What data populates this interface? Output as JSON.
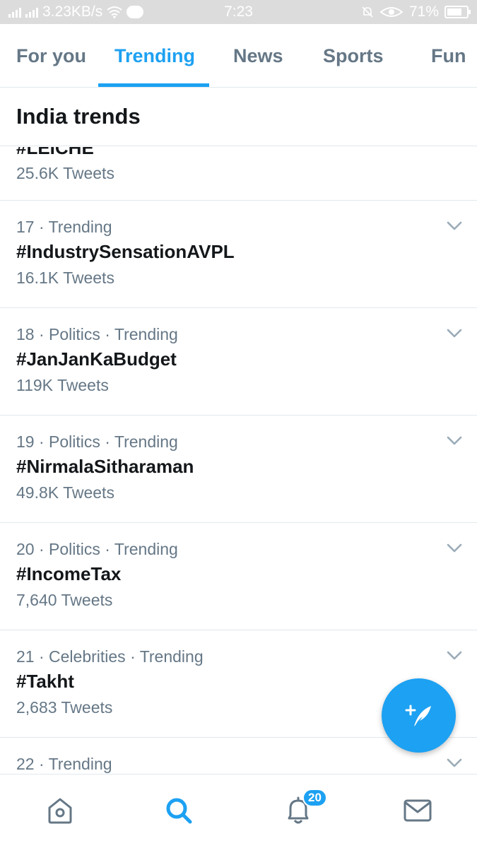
{
  "status_bar": {
    "network_speed": "3.23KB/s",
    "time": "7:23",
    "battery": "71%"
  },
  "tabs": [
    {
      "label": "For you",
      "active": false
    },
    {
      "label": "Trending",
      "active": true
    },
    {
      "label": "News",
      "active": false
    },
    {
      "label": "Sports",
      "active": false
    },
    {
      "label": "Fun",
      "active": false
    }
  ],
  "section": {
    "title": "India trends"
  },
  "trends": [
    {
      "meta": "",
      "name": "#LEICHE",
      "count": "25.6K Tweets"
    },
    {
      "meta": "17 · Trending",
      "name": "#IndustrySensationAVPL",
      "count": "16.1K Tweets"
    },
    {
      "meta": "18 · Politics · Trending",
      "name": "#JanJanKaBudget",
      "count": "119K Tweets"
    },
    {
      "meta": "19 · Politics · Trending",
      "name": "#NirmalaSitharaman",
      "count": "49.8K Tweets"
    },
    {
      "meta": "20 · Politics · Trending",
      "name": "#IncomeTax",
      "count": "7,640 Tweets"
    },
    {
      "meta": "21 · Celebrities · Trending",
      "name": "#Takht",
      "count": "2,683 Tweets"
    },
    {
      "meta": "22 · Trending",
      "name": "",
      "count": ""
    }
  ],
  "fab": {
    "icon": "compose-tweet-icon"
  },
  "bottom_nav": {
    "items": [
      {
        "icon": "home-icon",
        "active": false
      },
      {
        "icon": "search-icon",
        "active": true
      },
      {
        "icon": "notifications-icon",
        "active": false,
        "badge": "20"
      },
      {
        "icon": "messages-icon",
        "active": false
      }
    ]
  },
  "colors": {
    "accent": "#1da1f2",
    "text_primary": "#14171a",
    "text_secondary": "#657786",
    "divider": "#e1e8ed"
  }
}
